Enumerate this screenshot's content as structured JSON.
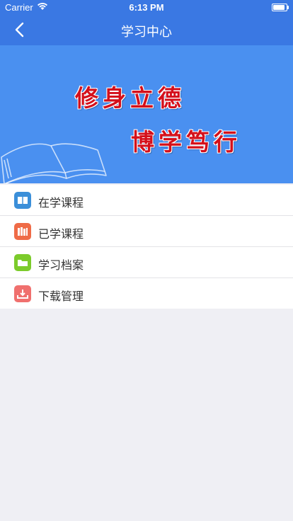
{
  "status_bar": {
    "carrier": "Carrier",
    "time": "6:13 PM",
    "battery_level": 0.9
  },
  "nav": {
    "title": "学习中心",
    "back_icon": "chevron-left-icon"
  },
  "banner": {
    "slogan_line1": "修身立德",
    "slogan_line2": "博学笃行",
    "art_icon": "open-book-icon"
  },
  "menu": {
    "items": [
      {
        "label": "在学课程",
        "icon": "book-icon",
        "color": "#3b8fd9"
      },
      {
        "label": "已学课程",
        "icon": "books-icon",
        "color": "#ef6b47"
      },
      {
        "label": "学习档案",
        "icon": "folder-icon",
        "color": "#7ccb2b"
      },
      {
        "label": "下载管理",
        "icon": "download-icon",
        "color": "#f0706e"
      }
    ]
  },
  "colors": {
    "primary": "#3a78e3",
    "banner": "#4a90f0",
    "background": "#efeff4"
  }
}
